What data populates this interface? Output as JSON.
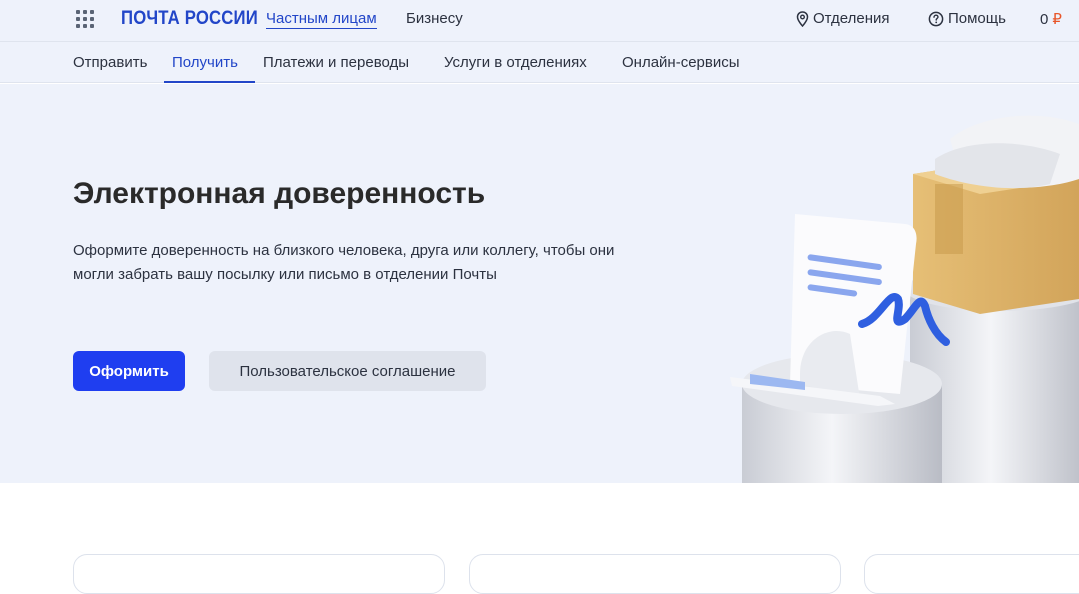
{
  "header": {
    "logo": "ПОЧТА РОССИИ",
    "segments": {
      "private": "Частным лицам",
      "business": "Бизнесу"
    },
    "offices": "Отделения",
    "help": "Помощь",
    "wallet_amount": "0",
    "currency": "₽"
  },
  "nav": {
    "items": [
      "Отправить",
      "Получить",
      "Платежи и переводы",
      "Услуги в отделениях",
      "Онлайн-сервисы"
    ],
    "active": "Получить"
  },
  "hero": {
    "title": "Электронная доверенность",
    "description": "Оформите доверенность на близкого человека, друга или коллегу, чтобы они могли забрать вашу посылку или письмо в отделении Почты",
    "primary_button": "Оформить",
    "secondary_button": "Пользовательское соглашение"
  },
  "colors": {
    "brand_blue": "#2246c8",
    "primary_button": "#1f3ef0",
    "background": "#eef2fb",
    "ruble_accent": "#e8562a"
  },
  "icons": [
    "apps-grid-icon",
    "location-pin-icon",
    "question-circle-icon"
  ]
}
